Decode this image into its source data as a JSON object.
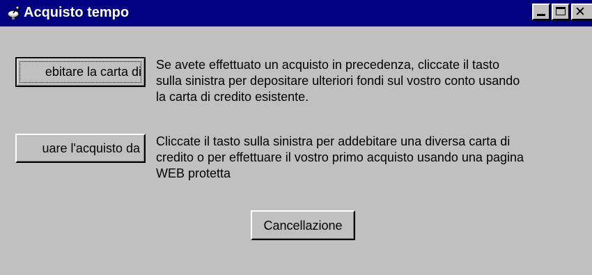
{
  "window": {
    "title": "Acquisto tempo",
    "controls": {
      "minimize": "minimize",
      "maximize": "maximize",
      "close": "close"
    },
    "app_icon": "satellite-dish-icon"
  },
  "options": [
    {
      "button_label": "ebitare la carta di",
      "description_lines": [
        "Se avete effettuato un acquisto in precedenza, cliccate il tasto",
        "sulla sinistra per depositare ulteriori fondi sul vostro conto usando",
        "la carta di credito esistente."
      ]
    },
    {
      "button_label": "uare l'acquisto da",
      "description_lines": [
        "Cliccate il tasto sulla sinistra per addebitare una diversa carta di",
        "credito o per effettuare il vostro primo acquisto usando una pagina",
        "WEB protetta"
      ]
    }
  ],
  "cancel_label": "Cancellazione",
  "colors": {
    "titlebar": "#000080",
    "face": "#c0c0c0",
    "title_text": "#ffffff"
  }
}
